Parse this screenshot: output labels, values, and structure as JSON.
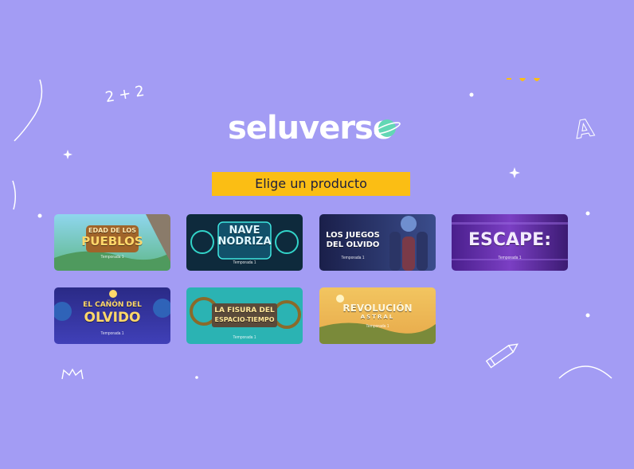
{
  "brand": {
    "name": "seluverso"
  },
  "cta": {
    "label": "Elige un producto"
  },
  "decor": {
    "math_doodle": "2 + 2",
    "letter_doodle": "A"
  },
  "products": [
    {
      "title_line1": "EDAD DE LOS",
      "title_line2": "PUEBLOS",
      "sub": "Temporada 1"
    },
    {
      "title_line1": "NAVE",
      "title_line2": "NODRIZA",
      "sub": "Temporada 1"
    },
    {
      "title_line1": "LOS JUEGOS",
      "title_line2": "DEL OLVIDO",
      "sub": "Temporada 1"
    },
    {
      "title_line1": "ESCAPE:",
      "title_line2": "",
      "sub": "Temporada 1"
    },
    {
      "title_line1": "EL CAÑÓN DEL",
      "title_line2": "OLVIDO",
      "sub": "Temporada 1"
    },
    {
      "title_line1": "LA FISURA DEL",
      "title_line2": "ESPACIO-TIEMPO",
      "sub": "Temporada 1"
    },
    {
      "title_line1": "REVOLUCIÓN",
      "title_line2": "ASTRAL",
      "sub": "Temporada 1"
    }
  ]
}
